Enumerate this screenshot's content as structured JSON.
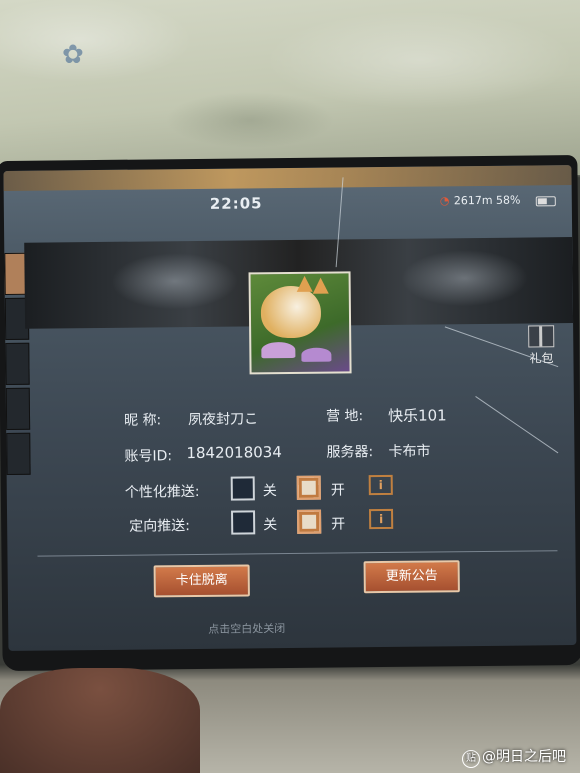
{
  "status": {
    "time": "22:05",
    "network": "2617m 58%"
  },
  "profile": {
    "nickname_label": "昵  称:",
    "nickname": "夙夜封刀こ",
    "camp_label": "营  地:",
    "camp": "快乐101",
    "account_label": "账号ID:",
    "account_id": "1842018034",
    "server_label": "服务器:",
    "server": "卡布市"
  },
  "settings": {
    "personalized_label": "个性化推送:",
    "targeted_label": "定向推送:",
    "off": "关",
    "on": "开",
    "info": "i"
  },
  "buttons": {
    "stuck": "卡住脱离",
    "notice": "更新公告"
  },
  "gift_label": "礼包",
  "hint": "点击空白处关闭",
  "watermark": "@明日之后吧"
}
